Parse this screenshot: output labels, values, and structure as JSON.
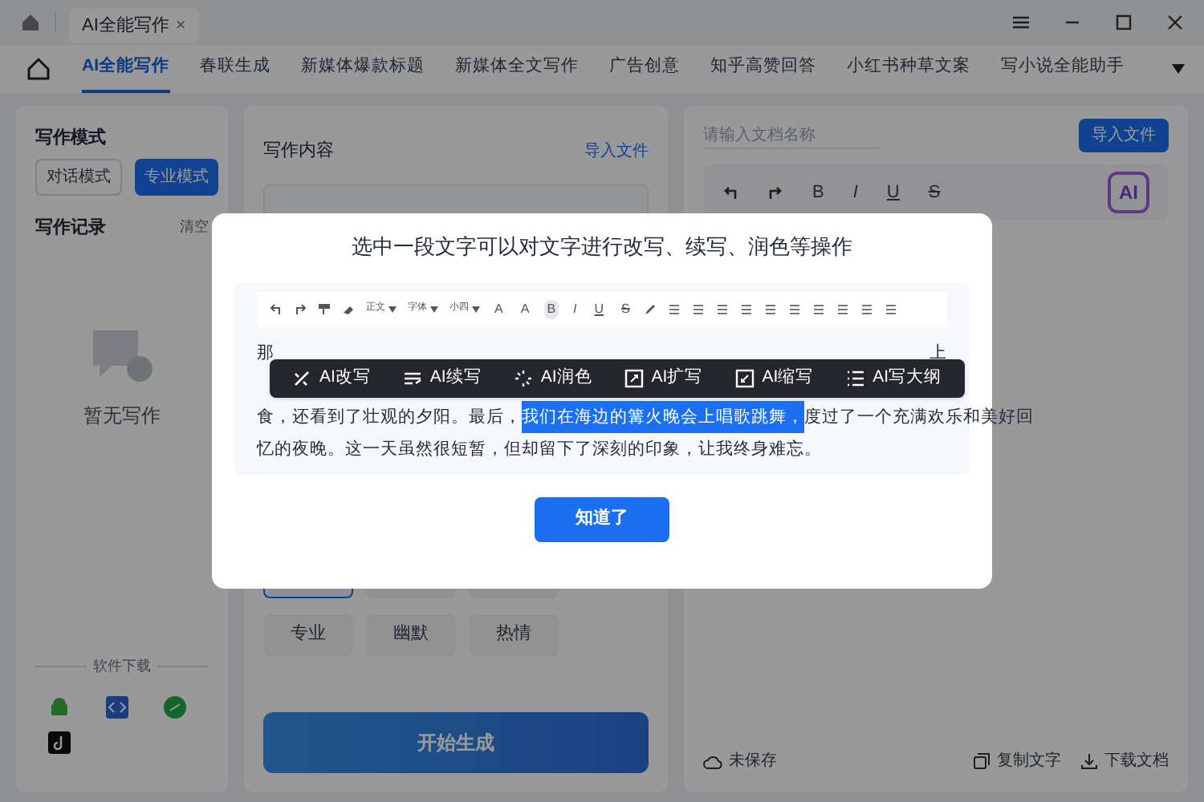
{
  "window": {
    "tab_title": "AI全能写作",
    "close": "×"
  },
  "nav_tabs": [
    {
      "label": "AI全能写作",
      "selected": true
    },
    {
      "label": "春联生成",
      "selected": false
    },
    {
      "label": "新媒体爆款标题",
      "selected": false
    },
    {
      "label": "新媒体全文写作",
      "selected": false
    },
    {
      "label": "广告创意",
      "selected": false
    },
    {
      "label": "知乎高赞回答",
      "selected": false
    },
    {
      "label": "小红书种草文案",
      "selected": false
    },
    {
      "label": "写小说全能助手",
      "selected": false
    }
  ],
  "left_panel": {
    "mode_label": "写作模式",
    "modes": [
      {
        "label": "对话模式",
        "selected": false
      },
      {
        "label": "专业模式",
        "selected": true
      }
    ],
    "history_label": "写作记录",
    "clear": "清空",
    "empty_text": "暂无写作",
    "download_label": "软件下载"
  },
  "middle_panel": {
    "content_label": "写作内容",
    "import_link": "导入文件",
    "tones": [
      {
        "label": "专业"
      },
      {
        "label": "幽默"
      },
      {
        "label": "热情"
      }
    ],
    "generate_button": "开始生成"
  },
  "right_panel": {
    "doc_name_placeholder": "请输入文档名称",
    "import_button": "导入文件",
    "toolbar": [
      "B",
      "I",
      "U",
      "S"
    ],
    "ai_button": "AI",
    "save_status": "未保存",
    "copy_button": "复制文字",
    "download_button": "下载文档"
  },
  "modal": {
    "title": "选中一段文字可以对文字进行改写、续写、润色等操作",
    "dropdowns": [
      "正文",
      "字体",
      "小四"
    ],
    "format_buttons": [
      {
        "label": "A",
        "selected": false
      },
      {
        "label": "A",
        "selected": false
      },
      {
        "label": "B",
        "selected": true
      },
      {
        "label": "I",
        "selected": false
      },
      {
        "label": "U",
        "selected": false
      },
      {
        "label": "S",
        "selected": false
      }
    ],
    "line_1": "那",
    "line_1_end": "上",
    "line_3_before": "食，还看到了壮观的夕阳。最后，",
    "line_3_selected": "我们在海边的篝火晚会上唱歌跳舞，",
    "line_3_after": "度过了一个充满欢乐和美好回",
    "line_4": "忆的夜晚。这一天虽然很短暂，但却留下了深刻的印象，让我终身难忘。",
    "ai_actions": [
      {
        "label": "AI改写",
        "kind": "rewrite"
      },
      {
        "label": "AI续写",
        "kind": "continue"
      },
      {
        "label": "AI润色",
        "kind": "polish"
      },
      {
        "label": "AI扩写",
        "kind": "expand"
      },
      {
        "label": "AI缩写",
        "kind": "shrink"
      },
      {
        "label": "AI写大纲",
        "kind": "outline"
      }
    ],
    "confirm_button": "知道了"
  }
}
